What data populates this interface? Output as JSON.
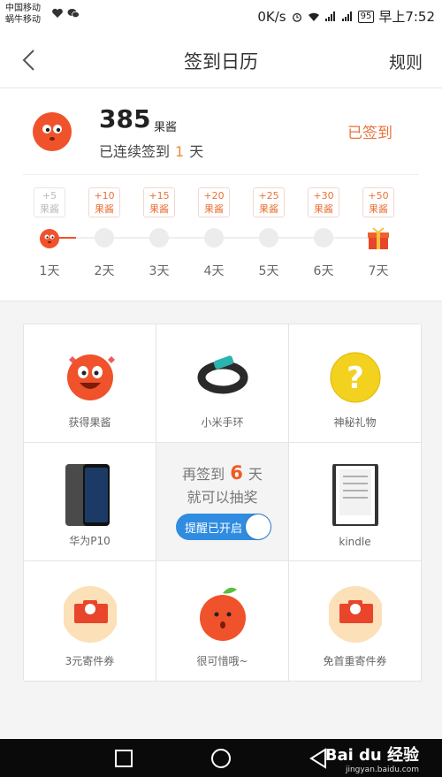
{
  "status_bar": {
    "carrier1": "中国移动",
    "carrier2": "蜗牛移动",
    "speed": "0K/s",
    "battery": "95",
    "time": "早上7:52"
  },
  "header": {
    "title": "签到日历",
    "rules": "规则"
  },
  "summary": {
    "points": "385",
    "points_unit": "果酱",
    "streak_prefix": "已连续签到",
    "streak_days": "1",
    "streak_suffix": "天",
    "signed_label": "已签到"
  },
  "days": [
    {
      "bonus": "+5",
      "unit": "果酱",
      "label": "1天",
      "done": true
    },
    {
      "bonus": "+10",
      "unit": "果酱",
      "label": "2天"
    },
    {
      "bonus": "+15",
      "unit": "果酱",
      "label": "3天"
    },
    {
      "bonus": "+20",
      "unit": "果酱",
      "label": "4天"
    },
    {
      "bonus": "+25",
      "unit": "果酱",
      "label": "5天"
    },
    {
      "bonus": "+30",
      "unit": "果酱",
      "label": "6天"
    },
    {
      "bonus": "+50",
      "unit": "果酱",
      "label": "7天"
    }
  ],
  "prizes": {
    "p1": "获得果酱",
    "p2": "小米手环",
    "p3": "神秘礼物",
    "p4": "华为P10",
    "p6": "kindle",
    "p7": "3元寄件券",
    "p8": "很可惜哦~",
    "p9": "免首重寄件券"
  },
  "center": {
    "line1_prefix": "再签到",
    "count": "6",
    "line1_suffix": "天",
    "line2": "就可以抽奖",
    "toggle_label": "提醒已开启"
  },
  "watermark": {
    "brand": "Bai du 经验",
    "url": "jingyan.baidu.com"
  },
  "colors": {
    "accent": "#e8733a",
    "blue": "#2f8ce0",
    "orange": "#f05a22"
  }
}
